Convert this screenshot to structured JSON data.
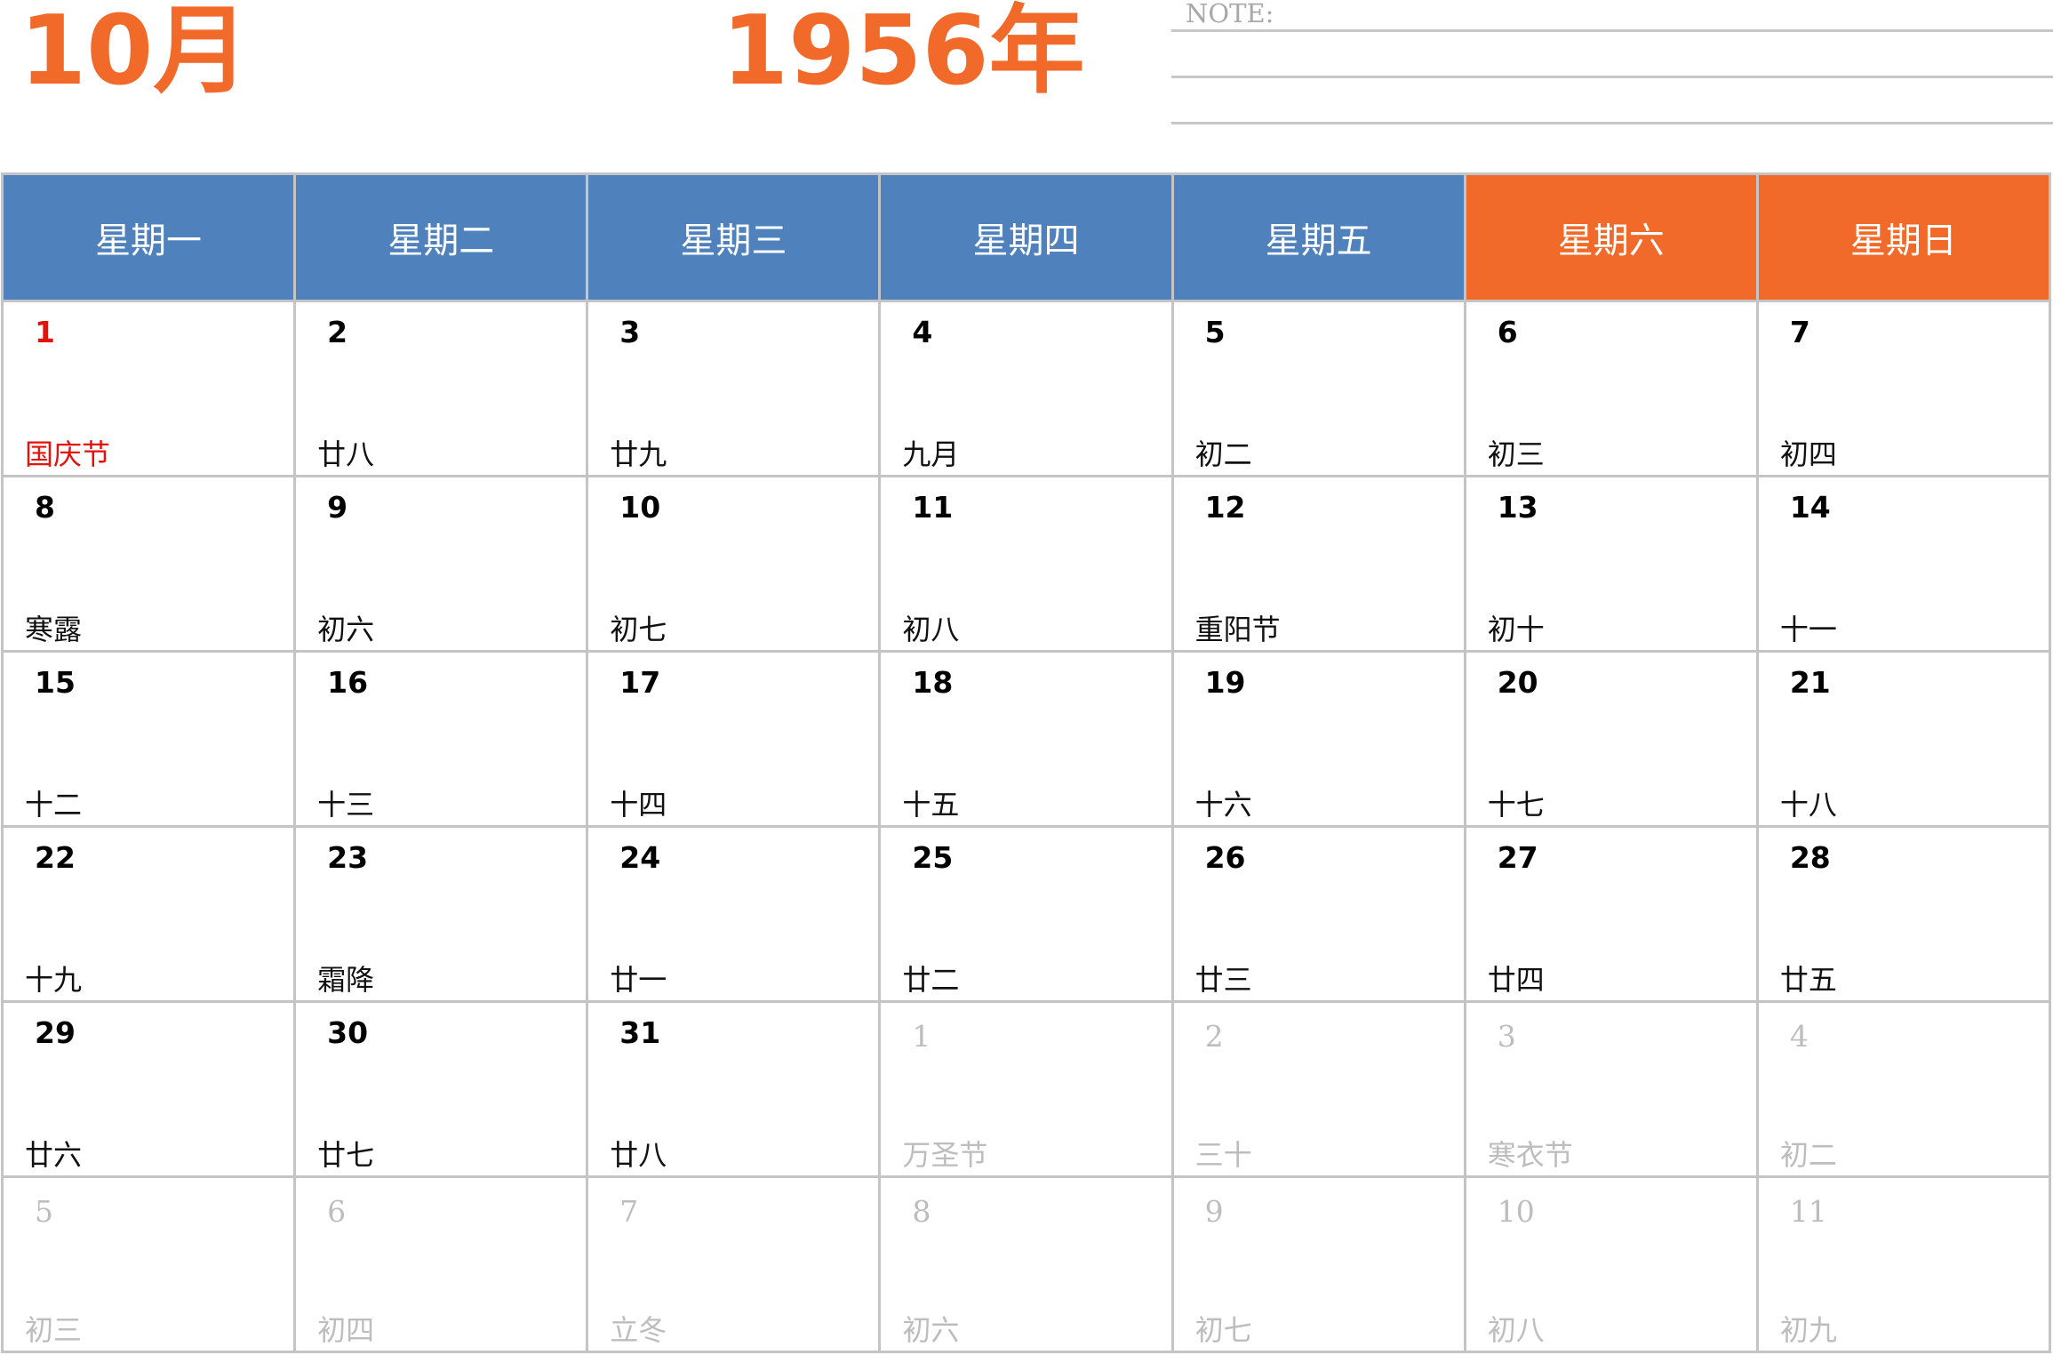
{
  "header": {
    "month": "10月",
    "year": "1956年",
    "note_label": "NOTE:"
  },
  "colors": {
    "accent": "#f26a2a",
    "weekday_header": "#4f81bd",
    "weekend_header": "#f26a2a",
    "holiday": "#e3120b",
    "muted": "#bdbdbd",
    "grid": "#c4c4c4"
  },
  "calendar": {
    "weekdays": [
      {
        "label": "星期一",
        "weekend": false
      },
      {
        "label": "星期二",
        "weekend": false
      },
      {
        "label": "星期三",
        "weekend": false
      },
      {
        "label": "星期四",
        "weekend": false
      },
      {
        "label": "星期五",
        "weekend": false
      },
      {
        "label": "星期六",
        "weekend": true
      },
      {
        "label": "星期日",
        "weekend": true
      }
    ],
    "days": [
      {
        "day": "1",
        "sub": "国庆节",
        "in_month": true,
        "holiday": true
      },
      {
        "day": "2",
        "sub": "廿八",
        "in_month": true,
        "holiday": false
      },
      {
        "day": "3",
        "sub": "廿九",
        "in_month": true,
        "holiday": false
      },
      {
        "day": "4",
        "sub": "九月",
        "in_month": true,
        "holiday": false
      },
      {
        "day": "5",
        "sub": "初二",
        "in_month": true,
        "holiday": false
      },
      {
        "day": "6",
        "sub": "初三",
        "in_month": true,
        "holiday": false
      },
      {
        "day": "7",
        "sub": "初四",
        "in_month": true,
        "holiday": false
      },
      {
        "day": "8",
        "sub": "寒露",
        "in_month": true,
        "holiday": false
      },
      {
        "day": "9",
        "sub": "初六",
        "in_month": true,
        "holiday": false
      },
      {
        "day": "10",
        "sub": "初七",
        "in_month": true,
        "holiday": false
      },
      {
        "day": "11",
        "sub": "初八",
        "in_month": true,
        "holiday": false
      },
      {
        "day": "12",
        "sub": "重阳节",
        "in_month": true,
        "holiday": false
      },
      {
        "day": "13",
        "sub": "初十",
        "in_month": true,
        "holiday": false
      },
      {
        "day": "14",
        "sub": "十一",
        "in_month": true,
        "holiday": false
      },
      {
        "day": "15",
        "sub": "十二",
        "in_month": true,
        "holiday": false
      },
      {
        "day": "16",
        "sub": "十三",
        "in_month": true,
        "holiday": false
      },
      {
        "day": "17",
        "sub": "十四",
        "in_month": true,
        "holiday": false
      },
      {
        "day": "18",
        "sub": "十五",
        "in_month": true,
        "holiday": false
      },
      {
        "day": "19",
        "sub": "十六",
        "in_month": true,
        "holiday": false
      },
      {
        "day": "20",
        "sub": "十七",
        "in_month": true,
        "holiday": false
      },
      {
        "day": "21",
        "sub": "十八",
        "in_month": true,
        "holiday": false
      },
      {
        "day": "22",
        "sub": "十九",
        "in_month": true,
        "holiday": false
      },
      {
        "day": "23",
        "sub": "霜降",
        "in_month": true,
        "holiday": false
      },
      {
        "day": "24",
        "sub": "廿一",
        "in_month": true,
        "holiday": false
      },
      {
        "day": "25",
        "sub": "廿二",
        "in_month": true,
        "holiday": false
      },
      {
        "day": "26",
        "sub": "廿三",
        "in_month": true,
        "holiday": false
      },
      {
        "day": "27",
        "sub": "廿四",
        "in_month": true,
        "holiday": false
      },
      {
        "day": "28",
        "sub": "廿五",
        "in_month": true,
        "holiday": false
      },
      {
        "day": "29",
        "sub": "廿六",
        "in_month": true,
        "holiday": false
      },
      {
        "day": "30",
        "sub": "廿七",
        "in_month": true,
        "holiday": false
      },
      {
        "day": "31",
        "sub": "廿八",
        "in_month": true,
        "holiday": false
      },
      {
        "day": "1",
        "sub": "万圣节",
        "in_month": false,
        "holiday": false
      },
      {
        "day": "2",
        "sub": "三十",
        "in_month": false,
        "holiday": false
      },
      {
        "day": "3",
        "sub": "寒衣节",
        "in_month": false,
        "holiday": false
      },
      {
        "day": "4",
        "sub": "初二",
        "in_month": false,
        "holiday": false
      },
      {
        "day": "5",
        "sub": "初三",
        "in_month": false,
        "holiday": false
      },
      {
        "day": "6",
        "sub": "初四",
        "in_month": false,
        "holiday": false
      },
      {
        "day": "7",
        "sub": "立冬",
        "in_month": false,
        "holiday": false
      },
      {
        "day": "8",
        "sub": "初六",
        "in_month": false,
        "holiday": false
      },
      {
        "day": "9",
        "sub": "初七",
        "in_month": false,
        "holiday": false
      },
      {
        "day": "10",
        "sub": "初八",
        "in_month": false,
        "holiday": false
      },
      {
        "day": "11",
        "sub": "初九",
        "in_month": false,
        "holiday": false
      }
    ]
  }
}
